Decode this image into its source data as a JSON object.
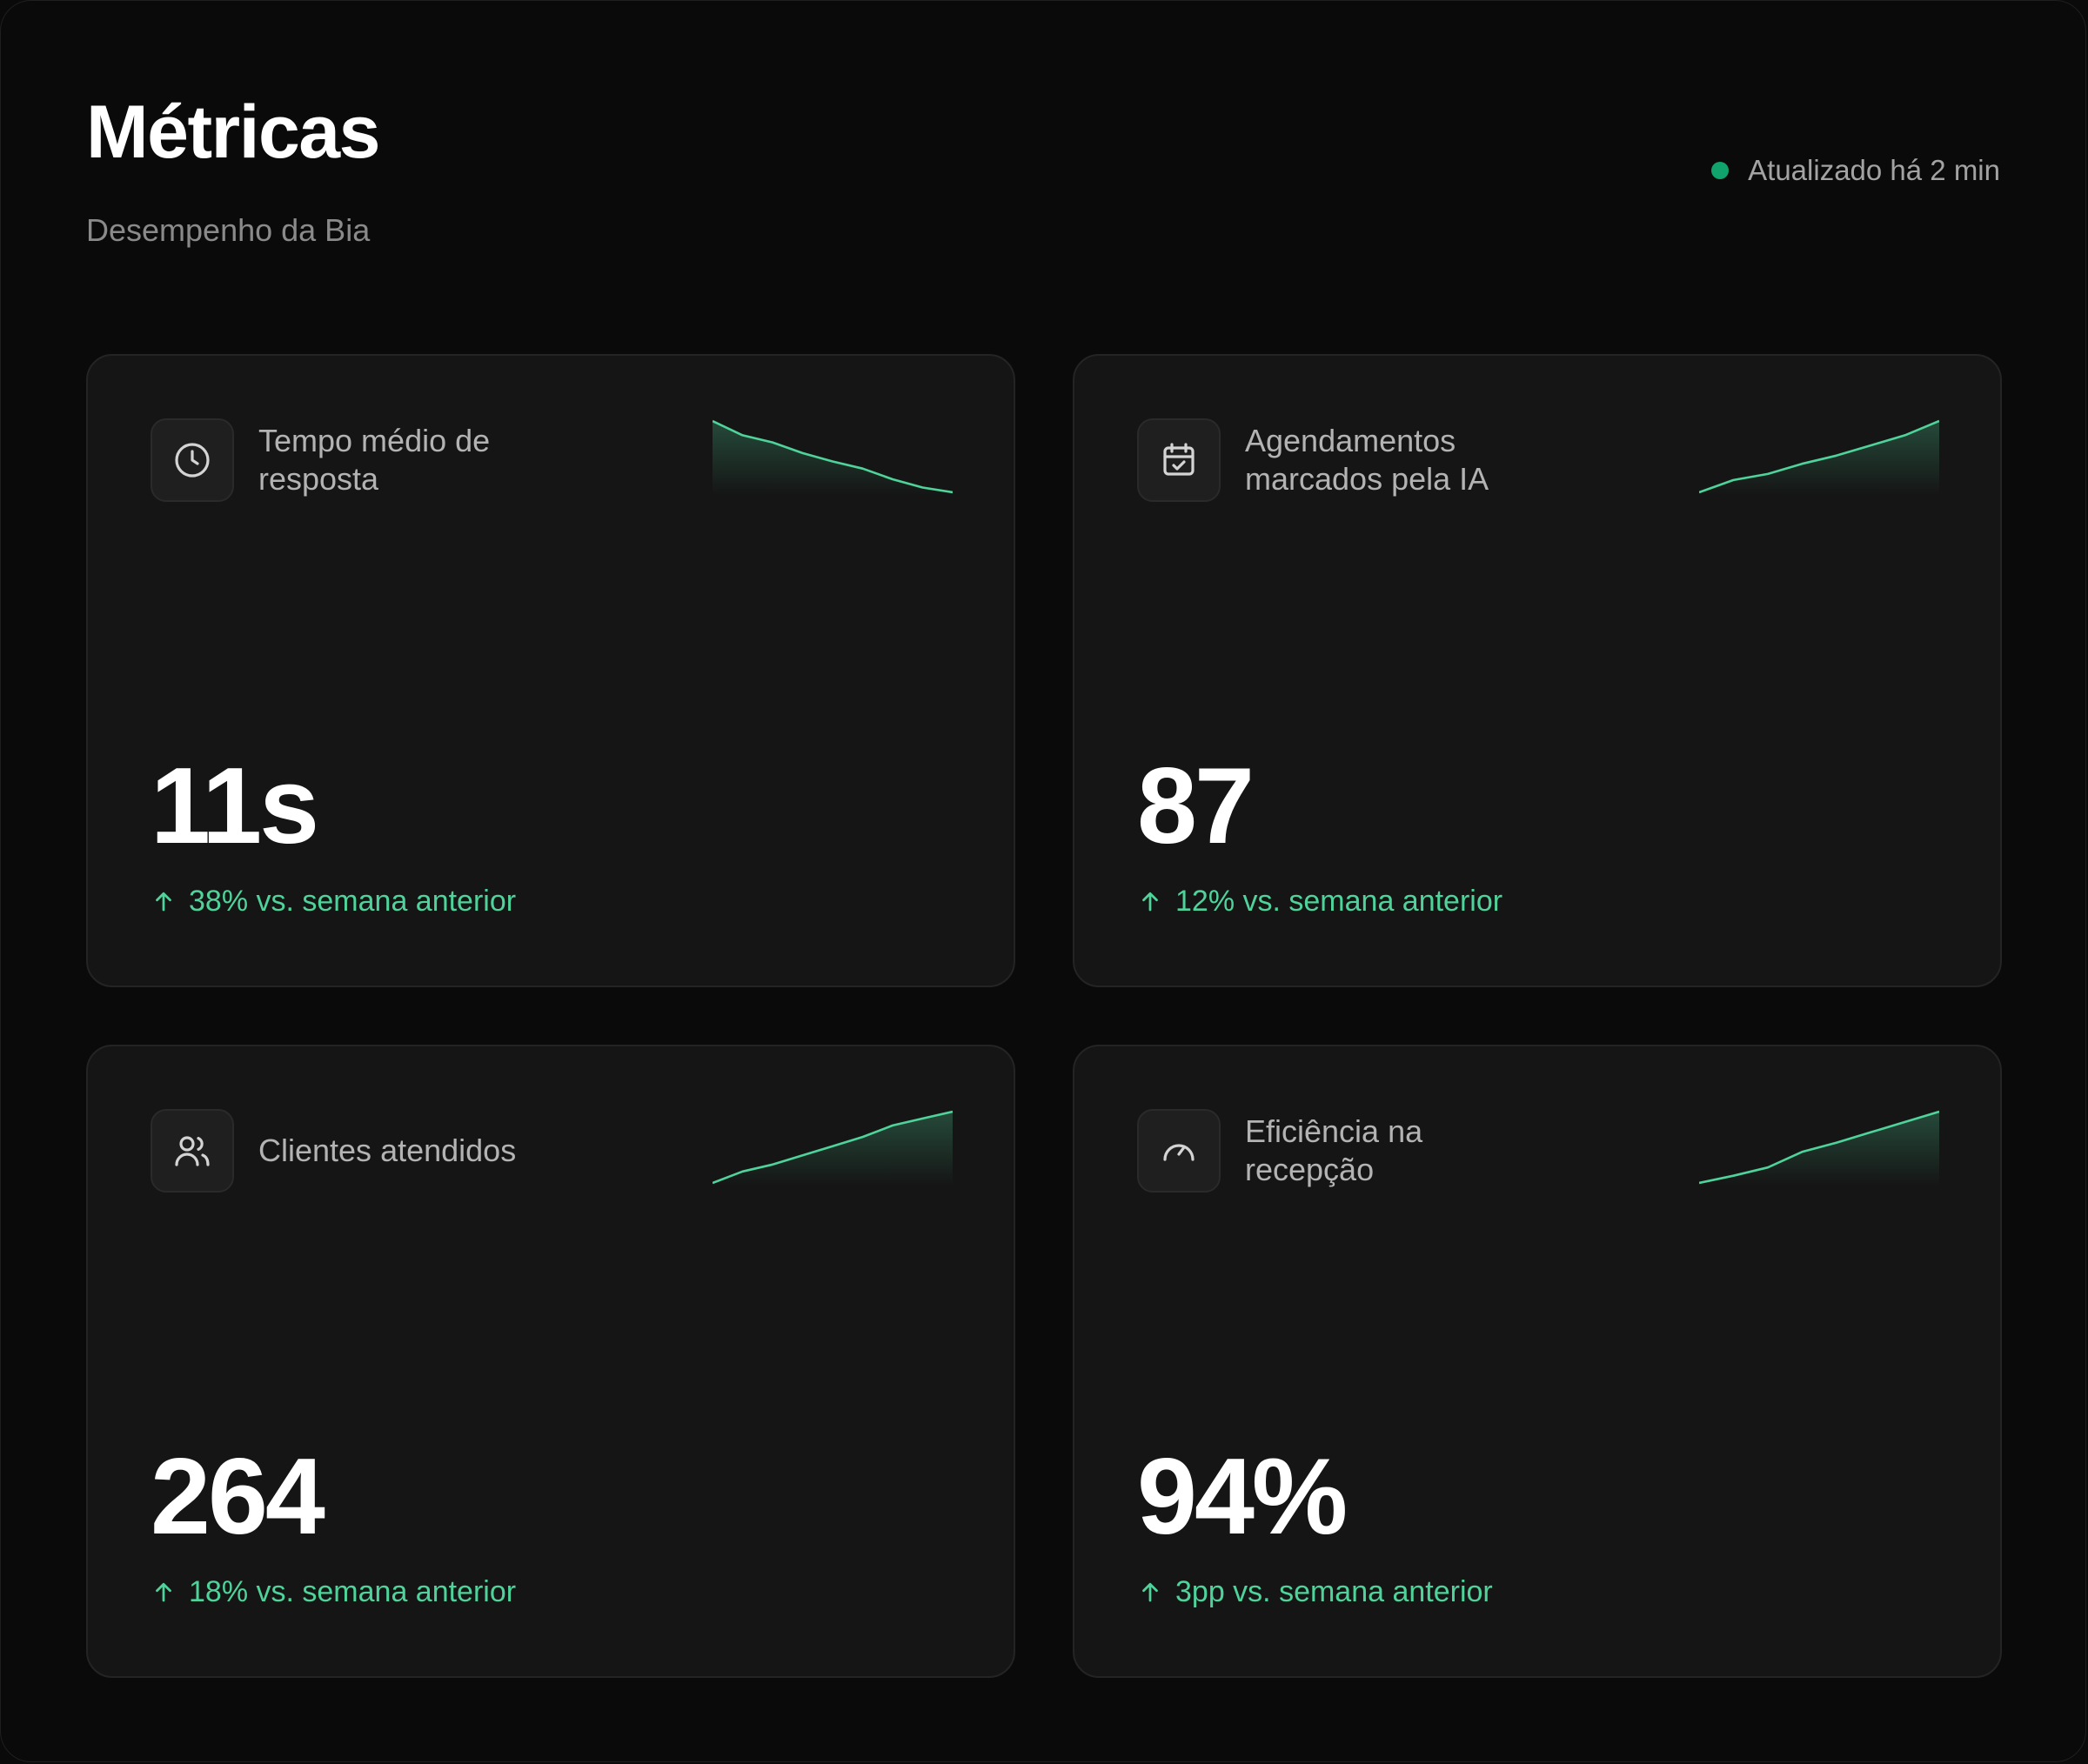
{
  "header": {
    "title": "Métricas",
    "subtitle": "Desempenho da Bia",
    "status": "Atualizado há 2 min"
  },
  "colors": {
    "accent": "#4fd39a",
    "status_dot": "#10a36b",
    "card_bg": "#151515",
    "page_bg": "#0a0a0a"
  },
  "cards": [
    {
      "icon": "clock-icon",
      "label": "Tempo médio de resposta",
      "value": "11s",
      "delta": "38% vs. semana anterior",
      "trend": [
        10,
        8.8,
        8.2,
        7.3,
        6.6,
        6.0,
        5.1,
        4.4,
        4.0
      ]
    },
    {
      "icon": "calendar-check-icon",
      "label": "Agendamentos marcados pela IA",
      "value": "87",
      "delta": "12% vs. semana anterior",
      "trend": [
        60,
        63,
        64.5,
        67,
        69,
        71.5,
        74,
        77.5
      ]
    },
    {
      "icon": "users-icon",
      "label": "Clientes atendidos",
      "value": "264",
      "delta": "18% vs. semana anterior",
      "trend": [
        200,
        205,
        208,
        212,
        216,
        220,
        225,
        228,
        231
      ]
    },
    {
      "icon": "gauge-icon",
      "label": "Eficiência na recepção",
      "value": "94%",
      "delta": "3pp vs. semana anterior",
      "trend": [
        85,
        86.4,
        88,
        91,
        92.8,
        94.8,
        96.8,
        98.8
      ]
    }
  ]
}
